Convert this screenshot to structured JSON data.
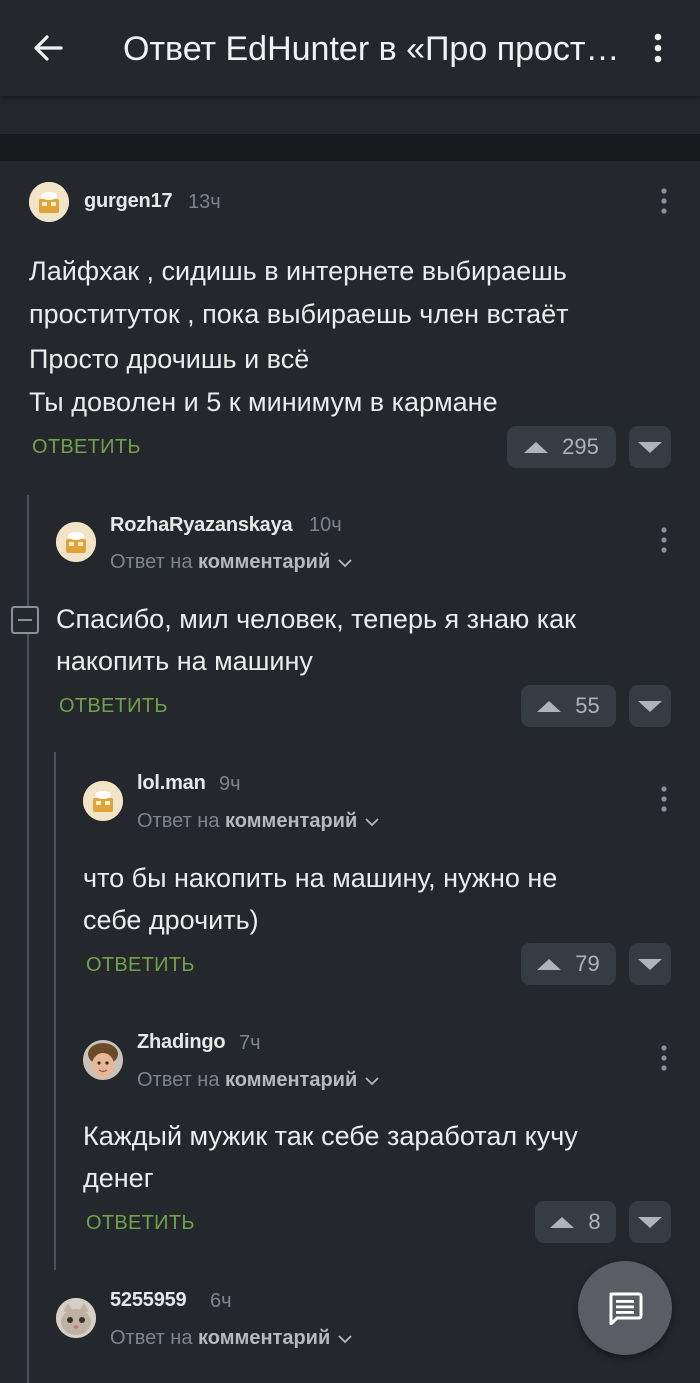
{
  "appbar": {
    "title": "Ответ EdHunter в «Про проститу…"
  },
  "common": {
    "reply_label": "ОТВЕТИТЬ",
    "reply_to_prefix": "Ответ на",
    "reply_to_target": "комментарий"
  },
  "comments": [
    {
      "username": "gurgen17",
      "time": "13ч",
      "text": [
        "Лайфхак , сидишь в интернете выбираешь",
        "проституток , пока выбираешь член встаёт",
        "Просто дрочишь и всё",
        "Ты доволен и 5 к минимум в кармане"
      ],
      "votes": "295"
    },
    {
      "username": "RozhaRyazanskaya",
      "time": "10ч",
      "text": [
        "Спасибо, мил человек, теперь я знаю как",
        "накопить на машину"
      ],
      "votes": "55"
    },
    {
      "username": "lol.man",
      "time": "9ч",
      "text": [
        "что бы накопить на машину, нужно не",
        "себе дрочить)"
      ],
      "votes": "79"
    },
    {
      "username": "Zhadingo",
      "time": "7ч",
      "text": [
        "Каждый мужик так себе заработал кучу",
        "денег"
      ],
      "votes": "8"
    },
    {
      "username": "5255959",
      "time": "6ч"
    }
  ],
  "colors": {
    "background": "#24272c",
    "accent_green": "#6fa24a",
    "muted": "#7f838a"
  }
}
